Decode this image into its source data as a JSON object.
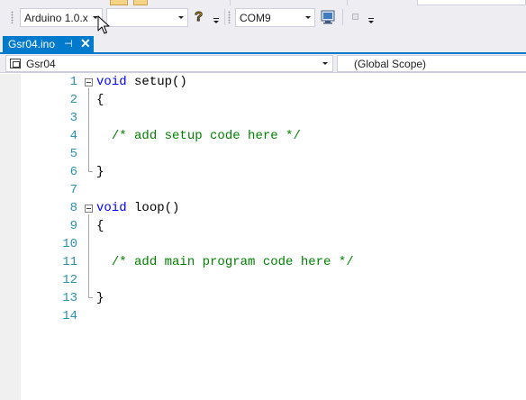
{
  "toolbar": {
    "board_combo": {
      "value": "Arduino 1.0.x"
    },
    "blank_combo": {
      "value": ""
    },
    "port_combo": {
      "value": "COM9"
    },
    "icons": [
      "help-icon",
      "serial-monitor-icon",
      "checkbox-icon"
    ]
  },
  "tab": {
    "title": "Gsr04.ino",
    "pin_icon": "⊣",
    "close_icon": "✕"
  },
  "navbar": {
    "file_scope": "Gsr04",
    "global_scope": "(Global Scope)"
  },
  "editor": {
    "lines": [
      {
        "num": "1",
        "keyword": "void",
        "rest": " setup()",
        "comment": ""
      },
      {
        "num": "2",
        "keyword": "",
        "rest": "{",
        "comment": ""
      },
      {
        "num": "3",
        "keyword": "",
        "rest": "",
        "comment": ""
      },
      {
        "num": "4",
        "keyword": "",
        "rest": "  ",
        "comment": "/* add setup code here */"
      },
      {
        "num": "5",
        "keyword": "",
        "rest": "",
        "comment": ""
      },
      {
        "num": "6",
        "keyword": "",
        "rest": "}",
        "comment": ""
      },
      {
        "num": "7",
        "keyword": "",
        "rest": "",
        "comment": ""
      },
      {
        "num": "8",
        "keyword": "void",
        "rest": " loop()",
        "comment": ""
      },
      {
        "num": "9",
        "keyword": "",
        "rest": "{",
        "comment": ""
      },
      {
        "num": "10",
        "keyword": "",
        "rest": "",
        "comment": ""
      },
      {
        "num": "11",
        "keyword": "",
        "rest": "  ",
        "comment": "/* add main program code here */"
      },
      {
        "num": "12",
        "keyword": "",
        "rest": "",
        "comment": ""
      },
      {
        "num": "13",
        "keyword": "",
        "rest": "}",
        "comment": ""
      },
      {
        "num": "14",
        "keyword": "",
        "rest": "",
        "comment": ""
      }
    ]
  },
  "colors": {
    "accent": "#007acc",
    "line_number": "#2b91af",
    "keyword": "#0000ff",
    "comment": "#008000",
    "chrome": "#eeeef2"
  }
}
